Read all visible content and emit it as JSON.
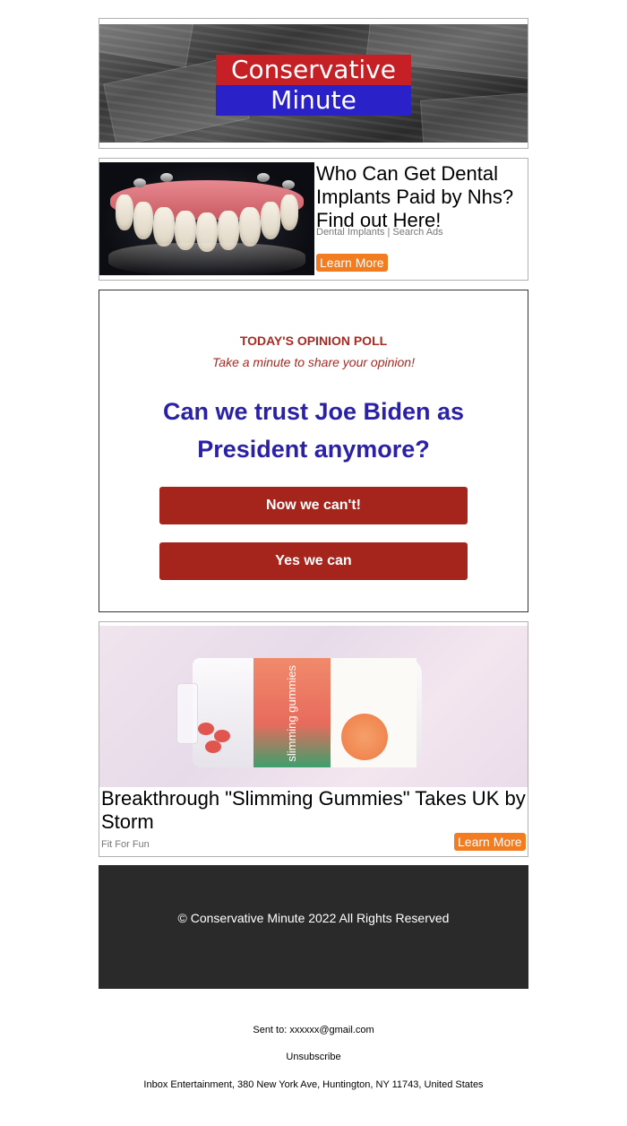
{
  "header": {
    "logo_line1": "Conservative",
    "logo_line2": "Minute",
    "colors": {
      "red": "#c42026",
      "blue": "#2a21c9"
    }
  },
  "ad1": {
    "title": "Who Can Get Dental Implants Paid by Nhs? Find out Here!",
    "source": "Dental Implants | Search Ads",
    "cta": "Learn More",
    "image": "dental-implants-photo"
  },
  "poll": {
    "heading": "TODAY'S OPINION POLL",
    "subheading": "Take a minute to share your opinion!",
    "question": "Can we trust Joe Biden as President anymore?",
    "options": [
      "Now we can't!",
      "Yes we can"
    ],
    "colors": {
      "accent": "#a82a22",
      "question": "#2a21a6",
      "button": "#a5241c"
    }
  },
  "ad2": {
    "title": "Breakthrough \"Slimming Gummies\" Takes UK by Storm",
    "source": "Fit For Fun",
    "cta": "Learn More",
    "bottle_label": "slimming gummies",
    "image": "slimming-gummies-bottle-photo"
  },
  "footer": {
    "copyright": "© Conservative Minute 2022 All Rights Reserved"
  },
  "meta_footer": {
    "sent_to": "Sent to: xxxxxx@gmail.com",
    "unsubscribe": "Unsubscribe",
    "address": "Inbox Entertainment, 380 New York Ave, Huntington, NY 11743, United States"
  },
  "cta_color": "#f47c20"
}
